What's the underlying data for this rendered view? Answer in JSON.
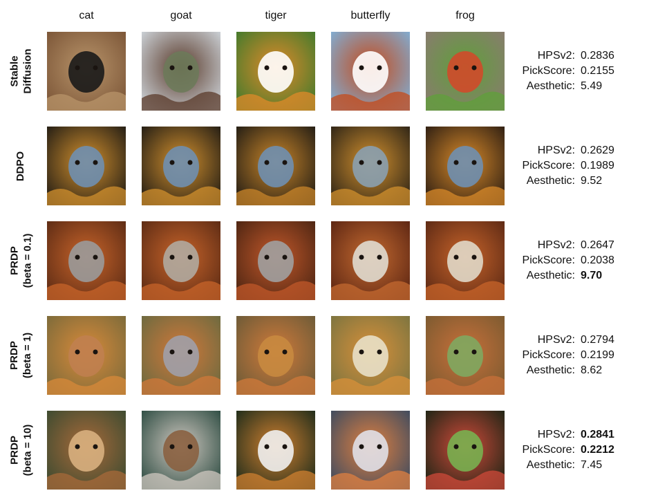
{
  "columns": [
    "cat",
    "goat",
    "tiger",
    "butterfly",
    "frog"
  ],
  "rows": [
    {
      "label_lines": [
        "Stable",
        "Diffusion"
      ],
      "metrics": [
        {
          "name": "HPSv2:",
          "value": "0.2836",
          "bold": false
        },
        {
          "name": "PickScore:",
          "value": "0.2155",
          "bold": false
        },
        {
          "name": "Aesthetic:",
          "value": "5.49",
          "bold": false
        }
      ]
    },
    {
      "label_lines": [
        "DDPO"
      ],
      "metrics": [
        {
          "name": "HPSv2:",
          "value": "0.2629",
          "bold": false
        },
        {
          "name": "PickScore:",
          "value": "0.1989",
          "bold": false
        },
        {
          "name": "Aesthetic:",
          "value": "9.52",
          "bold": false
        }
      ]
    },
    {
      "label_lines": [
        "PRDP",
        "(beta = 0.1)"
      ],
      "metrics": [
        {
          "name": "HPSv2:",
          "value": "0.2647",
          "bold": false
        },
        {
          "name": "PickScore:",
          "value": "0.2038",
          "bold": false
        },
        {
          "name": "Aesthetic:",
          "value": "9.70",
          "bold": true
        }
      ]
    },
    {
      "label_lines": [
        "PRDP",
        "(beta = 1)"
      ],
      "metrics": [
        {
          "name": "HPSv2:",
          "value": "0.2794",
          "bold": false
        },
        {
          "name": "PickScore:",
          "value": "0.2199",
          "bold": false
        },
        {
          "name": "Aesthetic:",
          "value": "8.62",
          "bold": false
        }
      ]
    },
    {
      "label_lines": [
        "PRDP",
        "(beta = 10)"
      ],
      "metrics": [
        {
          "name": "HPSv2:",
          "value": "0.2841",
          "bold": true
        },
        {
          "name": "PickScore:",
          "value": "0.2212",
          "bold": true
        },
        {
          "name": "Aesthetic:",
          "value": "7.45",
          "bold": false
        }
      ]
    }
  ]
}
